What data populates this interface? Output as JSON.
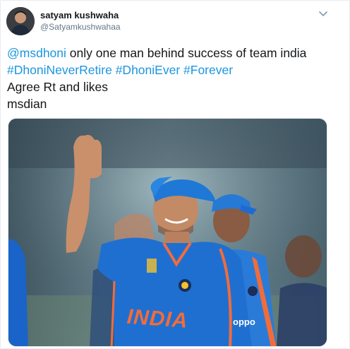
{
  "author": {
    "name": "satyam kushwaha",
    "handle": "@Satyamkushwahaa"
  },
  "icons": {
    "menu": "chevron-down-icon"
  },
  "tweet": {
    "mention": "@msdhoni",
    "line1_rest": " only one man behind success of team india",
    "hashtags": [
      "#DhoniNeverRetire",
      "#DhoniEver",
      "#Forever"
    ],
    "line3": "Agree Rt and likes",
    "line4": "msdian"
  },
  "media": {
    "jersey_text": "INDIA",
    "sponsor_text": "oppo"
  },
  "colors": {
    "link": "#1b95e0",
    "text": "#14171a",
    "secondary": "#657786",
    "jersey": "#1f6fd1",
    "jersey_text": "#f26c3a"
  }
}
